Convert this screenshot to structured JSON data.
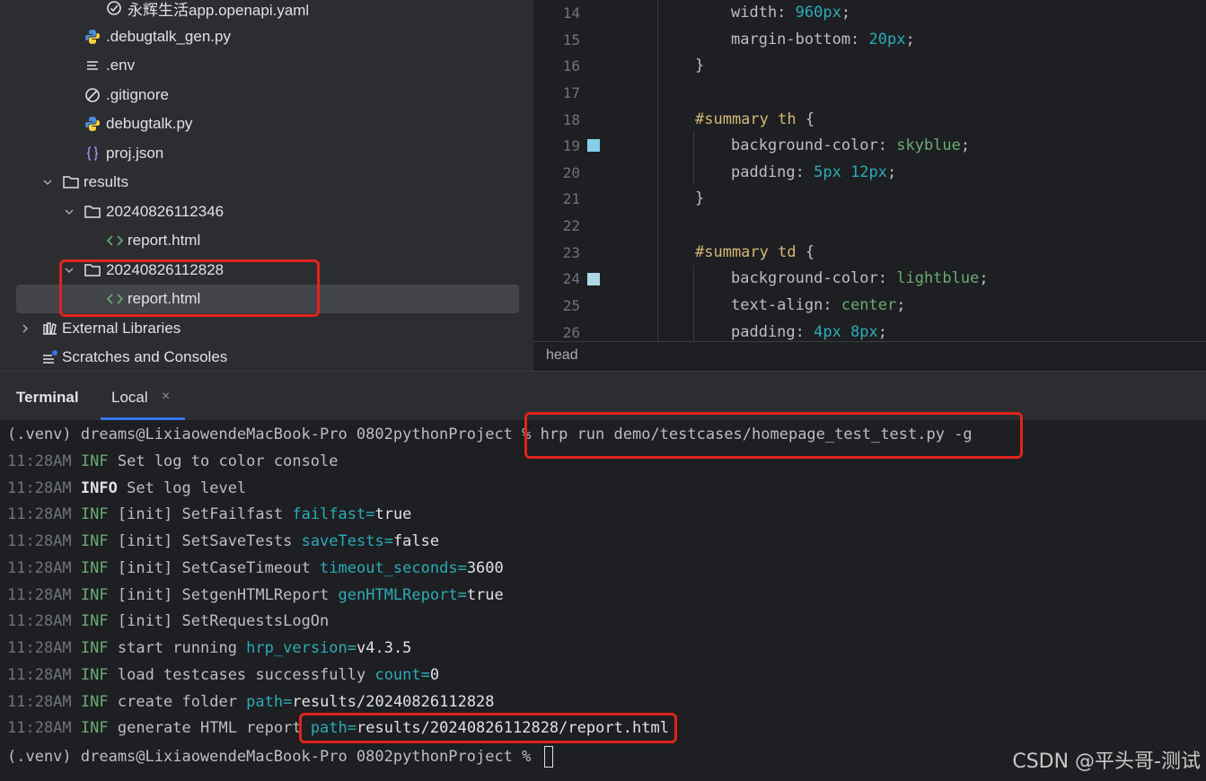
{
  "project_tree": {
    "items": [
      {
        "label": "永辉生活app.openapi.yaml",
        "icon": "openapi-icon"
      },
      {
        "label": ".debugtalk_gen.py",
        "icon": "python-icon"
      },
      {
        "label": ".env",
        "icon": "env-file-icon"
      },
      {
        "label": ".gitignore",
        "icon": "gitignore-icon"
      },
      {
        "label": "debugtalk.py",
        "icon": "python-icon"
      },
      {
        "label": "proj.json",
        "icon": "json-icon"
      },
      {
        "label": "results",
        "icon": "folder-icon"
      },
      {
        "label": "20240826112346",
        "icon": "folder-icon"
      },
      {
        "label": "report.html",
        "icon": "html-icon"
      },
      {
        "label": "20240826112828",
        "icon": "folder-icon"
      },
      {
        "label": "report.html",
        "icon": "html-icon"
      },
      {
        "label": "External Libraries",
        "icon": "library-icon"
      },
      {
        "label": "Scratches and Consoles",
        "icon": "scratches-icon"
      }
    ]
  },
  "editor": {
    "line_numbers": [
      "14",
      "15",
      "16",
      "17",
      "18",
      "19",
      "20",
      "21",
      "22",
      "23",
      "24",
      "25",
      "26"
    ],
    "lines": {
      "l14": {
        "prop": "width: ",
        "num": "960px",
        "end": ";"
      },
      "l15": {
        "prop": "margin-bottom: ",
        "num": "20px",
        "end": ";"
      },
      "l16": {
        "text": "}"
      },
      "l18": {
        "sel": "#summary th",
        "end": " {"
      },
      "l19": {
        "prop": "background-color: ",
        "val": "skyblue",
        "end": ";"
      },
      "l20": {
        "prop": "padding: ",
        "num": "5px 12px",
        "end": ";"
      },
      "l21": {
        "text": "}"
      },
      "l23": {
        "sel": "#summary td",
        "end": " {"
      },
      "l24": {
        "prop": "background-color: ",
        "val": "lightblue",
        "end": ";"
      },
      "l25": {
        "prop": "text-align: ",
        "val": "center",
        "end": ";"
      },
      "l26": {
        "prop": "padding: ",
        "num": "4px 8px",
        "end": ";"
      }
    },
    "swatch_colors": {
      "skyblue": "#87ceeb",
      "lightblue": "#add8e6"
    },
    "breadcrumb": "head"
  },
  "terminal": {
    "panel_title": "Terminal",
    "tab_label": "Local",
    "tab_close": "×",
    "prompt": "(.venv) dreams@LixiaowendeMacBook-Pro 0802pythonProject % ",
    "command": "hrp run demo/testcases/homepage_test_test.py -g",
    "lines": [
      {
        "time": "11:28AM",
        "level": "INF",
        "msg": "Set log to color console",
        "key": "",
        "val": ""
      },
      {
        "time": "11:28AM",
        "level": "INFO",
        "msg": "Set log level",
        "key": "",
        "val": ""
      },
      {
        "time": "11:28AM",
        "level": "INF",
        "msg": "[init] SetFailfast ",
        "key": "failfast=",
        "val": "true"
      },
      {
        "time": "11:28AM",
        "level": "INF",
        "msg": "[init] SetSaveTests ",
        "key": "saveTests=",
        "val": "false"
      },
      {
        "time": "11:28AM",
        "level": "INF",
        "msg": "[init] SetCaseTimeout ",
        "key": "timeout_seconds=",
        "val": "3600"
      },
      {
        "time": "11:28AM",
        "level": "INF",
        "msg": "[init] SetgenHTMLReport ",
        "key": "genHTMLReport=",
        "val": "true"
      },
      {
        "time": "11:28AM",
        "level": "INF",
        "msg": "[init] SetRequestsLogOn",
        "key": "",
        "val": ""
      },
      {
        "time": "11:28AM",
        "level": "INF",
        "msg": "start running ",
        "key": "hrp_version=",
        "val": "v4.3.5"
      },
      {
        "time": "11:28AM",
        "level": "INF",
        "msg": "load testcases successfully ",
        "key": "count=",
        "val": "0"
      },
      {
        "time": "11:28AM",
        "level": "INF",
        "msg": "create folder ",
        "key": "path=",
        "val": "results/20240826112828"
      },
      {
        "time": "11:28AM",
        "level": "INF",
        "msg": "generate HTML report ",
        "key": "path=",
        "val": "results/20240826112828/report.html"
      }
    ],
    "final_prompt": "(.venv) dreams@LixiaowendeMacBook-Pro 0802pythonProject % "
  },
  "watermark": "CSDN @平头哥-测试",
  "colors": {
    "highlight": "#e0241d",
    "accent": "#3574f0"
  }
}
